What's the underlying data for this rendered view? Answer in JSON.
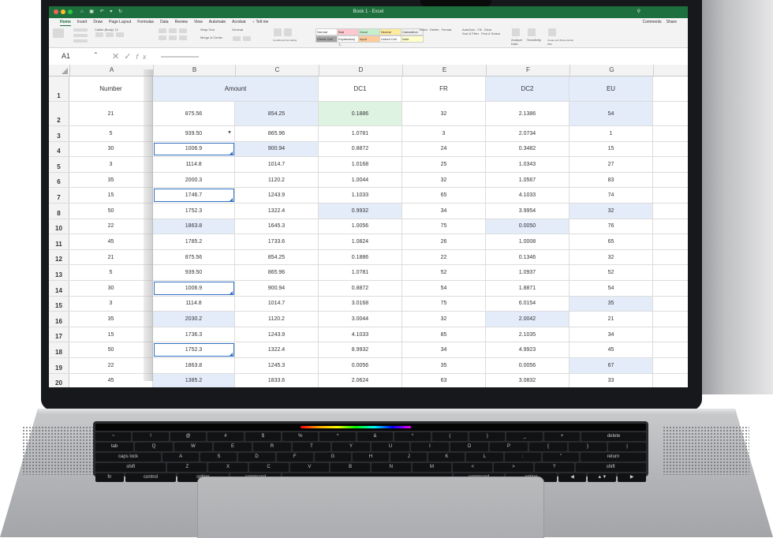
{
  "window": {
    "title": "Book 1 - Excel",
    "traffic_colors": [
      "#ff5f57",
      "#febc2e",
      "#28c840"
    ],
    "qat": "⌂ ▣ ↶ ▾ ↻",
    "search_icon": "search-icon"
  },
  "tabs": [
    "Home",
    "Insert",
    "Draw",
    "Page Layout",
    "Formulas",
    "Data",
    "Review",
    "View",
    "Automate",
    "Acrobat",
    "♀ Tell me"
  ],
  "tabs_right": [
    "Comments",
    "Share"
  ],
  "ribbon": {
    "font_name": "Calibri (Body)",
    "font_size": "12",
    "wrap_text": "Wrap Text",
    "merge": "Merge & Center",
    "number_format": "General",
    "cond_format": "Conditional Formatting",
    "format_table": "Format as Table",
    "styles": [
      "Normal",
      "Bad",
      "Good",
      "Neutral",
      "Calculation",
      "Check Cell",
      "Explanatory T...",
      "Input",
      "Linked Cell",
      "Note"
    ],
    "cells": [
      "Insert",
      "Delete",
      "Format"
    ],
    "editing": [
      "AutoSum",
      "Fill",
      "Clear",
      "Sort & Filter",
      "Find & Select"
    ],
    "analyze": "Analyze Data",
    "sensitivity": "Sensitivity",
    "pdf": "Create and Share Adobe PDF"
  },
  "formula_bar": {
    "name_box": "A1"
  },
  "accent": "#1e6f3e",
  "selection_color": "#2f6fc3",
  "columns": [
    "A",
    "B",
    "C",
    "D",
    "E",
    "F",
    "G"
  ],
  "header_row": {
    "row": "1",
    "number": "Number",
    "amount": "Amount",
    "dc1": "DC1",
    "fr": "FR",
    "dc2": "DC2",
    "eu": "EU"
  },
  "rows": [
    {
      "r": "2",
      "cells": [
        "21",
        "875.56",
        "854.25",
        "0.1886",
        "32",
        "2.1386",
        "54"
      ]
    },
    {
      "r": "3",
      "cells": [
        "5",
        "939.50",
        "865.96",
        "1.0781",
        "3",
        "2.0734",
        "1"
      ]
    },
    {
      "r": "4",
      "cells": [
        "30",
        "1006.9",
        "900.94",
        "0.8872",
        "24",
        "0.3482",
        "15"
      ]
    },
    {
      "r": "5",
      "cells": [
        "3",
        "1114.8",
        "1014.7",
        "1.0168",
        "25",
        "1.0343",
        "27"
      ]
    },
    {
      "r": "6",
      "cells": [
        "35",
        "2000.3",
        "1120.2",
        "1.0044",
        "32",
        "1.0567",
        "83"
      ]
    },
    {
      "r": "7",
      "cells": [
        "15",
        "1746.7",
        "1243.9",
        "1.1033",
        "65",
        "4.1033",
        "74"
      ]
    },
    {
      "r": "8",
      "cells": [
        "50",
        "1752.3",
        "1322.4",
        "0.9932",
        "34",
        "3.9954",
        "32"
      ]
    },
    {
      "r": "10",
      "cells": [
        "22",
        "1863.8",
        "1645.3",
        "1.0056",
        "75",
        "0.0050",
        "76"
      ]
    },
    {
      "r": "11",
      "cells": [
        "45",
        "1785.2",
        "1733.6",
        "1.0824",
        "26",
        "1.0008",
        "65"
      ]
    },
    {
      "r": "12",
      "cells": [
        "21",
        "875.56",
        "854.25",
        "0.1886",
        "22",
        "0.1346",
        "32"
      ]
    },
    {
      "r": "13",
      "cells": [
        "5",
        "939.50",
        "865.96",
        "1.0781",
        "52",
        "1.0937",
        "52"
      ]
    },
    {
      "r": "14",
      "cells": [
        "30",
        "1006.9",
        "900.94",
        "0.8872",
        "54",
        "1.8871",
        "54"
      ]
    },
    {
      "r": "15",
      "cells": [
        "3",
        "1114.8",
        "1014.7",
        "3.0168",
        "75",
        "6.0154",
        "35"
      ]
    },
    {
      "r": "16",
      "cells": [
        "35",
        "2030.2",
        "1120.2",
        "3.0044",
        "32",
        "2.0042",
        "21"
      ]
    },
    {
      "r": "17",
      "cells": [
        "15",
        "1736.3",
        "1243.9",
        "4.1033",
        "85",
        "2.1035",
        "34"
      ]
    },
    {
      "r": "18",
      "cells": [
        "50",
        "1752.3",
        "1322.4",
        "8.9932",
        "34",
        "4.9923",
        "45"
      ]
    },
    {
      "r": "19",
      "cells": [
        "22",
        "1863.8",
        "1245.3",
        "0.0056",
        "35",
        "0.0056",
        "67"
      ]
    },
    {
      "r": "20",
      "cells": [
        "45",
        "1385.2",
        "1833.6",
        "2.0624",
        "63",
        "3.0832",
        "33"
      ]
    }
  ],
  "keyboard": {
    "top_row": [
      "esc",
      "",
      "",
      "",
      "",
      "",
      "",
      "",
      "",
      "",
      "",
      "",
      "",
      "",
      "",
      "delete"
    ],
    "row2": [
      "~",
      "!",
      "@",
      "#",
      "$",
      "%",
      "^",
      "&",
      "*",
      "(",
      ")",
      "_",
      "+",
      "delete"
    ],
    "row3": [
      "tab",
      "Q",
      "W",
      "E",
      "R",
      "T",
      "Y",
      "U",
      "I",
      "O",
      "P",
      "{",
      "}",
      "|"
    ],
    "row4": [
      "caps lock",
      "A",
      "S",
      "D",
      "F",
      "G",
      "H",
      "J",
      "K",
      "L",
      ":",
      "\"",
      "return"
    ],
    "row5": [
      "shift",
      "Z",
      "X",
      "C",
      "V",
      "B",
      "N",
      "M",
      "<",
      ">",
      "?",
      "shift"
    ],
    "row6": [
      "fn",
      "control",
      "option",
      "command",
      "",
      "command",
      "option",
      "◀",
      "▲▼",
      "▶"
    ]
  }
}
